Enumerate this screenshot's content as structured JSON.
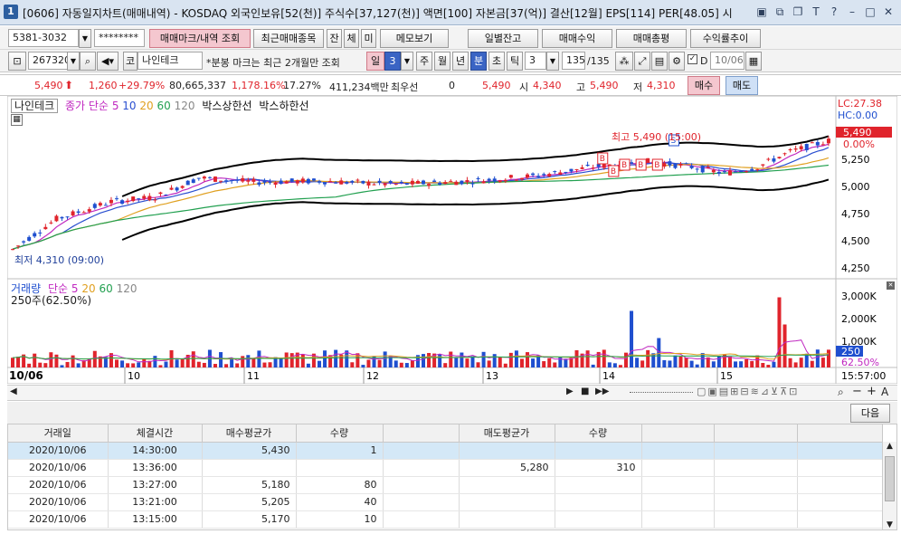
{
  "titlebar": {
    "window_num": "1",
    "title": "[0606] 자동일지차트(매매내역) - KOSDAQ 외국인보유[52(천)] 주식수[37,127(천)] 액면[100] 자본금[37(억)] 결산[12월] EPS[114] PER[48.05] 시"
  },
  "toolbar1": {
    "account": "5381-3032",
    "password": "********",
    "btn_trade_mark": "매매마크/내역 조회",
    "btn_recent": "최근매매종목",
    "btn_jan": "잔",
    "btn_che": "체",
    "btn_mi": "미",
    "btn_memo": "메모보기",
    "btn_daily_balance": "일별잔고",
    "btn_trade_profit": "매매수익",
    "btn_trade_total": "매매총평",
    "btn_profit_trend": "수익률추이"
  },
  "toolbar2": {
    "code": "267320",
    "market": "코",
    "name": "나인테크",
    "note": "*분봉 마크는 최근 2개월만 조회",
    "period_il": "일",
    "period_value": "3",
    "period_ju": "주",
    "period_wol": "월",
    "period_nyeon": "년",
    "period_bun": "분",
    "period_cho": "초",
    "period_tik": "틱",
    "tick_value": "3",
    "count": "135",
    "count_total": "/135",
    "date": "10/06",
    "check_label": "D"
  },
  "pricebar": {
    "price": "5,490",
    "change": "1,260",
    "rate": "+29.79%",
    "volume": "80,665,337",
    "vol_rate": "1,178.16%",
    "turnover": "17.27%",
    "amount": "411,234백만",
    "pref_label": "최우선",
    "pref_value": "0",
    "ask": "5,490",
    "open_label": "시",
    "open": "4,340",
    "high_label": "고",
    "high": "5,490",
    "low_label": "저",
    "low": "4,310",
    "buy_btn": "매수",
    "sell_btn": "매도"
  },
  "chart_legend": {
    "stock_name": "나인테크",
    "ma_label": "종가 단순",
    "ma5": "5",
    "ma10": "10",
    "ma20": "20",
    "ma60": "60",
    "ma120": "120",
    "band_upper": "박스상한선",
    "band_lower": "박스하한선",
    "lc": "LC:27.38",
    "hc": "HC:0.00",
    "price_tag": "5,490",
    "pct_tag": "0.00%",
    "low_note": "최저 4,310 (09:00)",
    "high_note": "최고 5,490 (15:00)"
  },
  "volume_legend": {
    "label": "거래량",
    "ma_label": "단순",
    "ma5": "5",
    "ma20": "20",
    "ma60": "60",
    "ma120": "120",
    "sub": "250주(62.50%)",
    "tag_vol": "250",
    "tag_pct": "62.50%"
  },
  "axis": {
    "price_ticks": [
      "5,250",
      "5,000",
      "4,750",
      "4,500",
      "4,250"
    ],
    "volume_ticks": [
      "3,000K",
      "2,000K",
      "1,000K"
    ],
    "x_labels": [
      "10/06",
      "10",
      "11",
      "12",
      "13",
      "14",
      "15"
    ],
    "time_label": "15:57:00"
  },
  "next_btn": "다음",
  "table": {
    "headers": [
      "거래일",
      "체결시간",
      "매수평균가",
      "수량",
      "",
      "매도평균가",
      "수량",
      "",
      "",
      ""
    ],
    "rows": [
      [
        "2020/10/06",
        "14:30:00",
        "5,430",
        "1",
        "",
        "",
        "",
        "",
        "",
        ""
      ],
      [
        "2020/10/06",
        "13:36:00",
        "",
        "",
        "",
        "5,280",
        "310",
        "",
        "",
        ""
      ],
      [
        "2020/10/06",
        "13:27:00",
        "5,180",
        "80",
        "",
        "",
        "",
        "",
        "",
        ""
      ],
      [
        "2020/10/06",
        "13:21:00",
        "5,205",
        "40",
        "",
        "",
        "",
        "",
        "",
        ""
      ],
      [
        "2020/10/06",
        "13:15:00",
        "5,170",
        "10",
        "",
        "",
        "",
        "",
        "",
        ""
      ]
    ]
  },
  "colors": {
    "up": "#e0242c",
    "down": "#1f4fcf",
    "ma5": "#c028c0",
    "ma10": "#2a4fd0",
    "ma20": "#e0a020",
    "ma60": "#22a050",
    "band": "#000000"
  }
}
